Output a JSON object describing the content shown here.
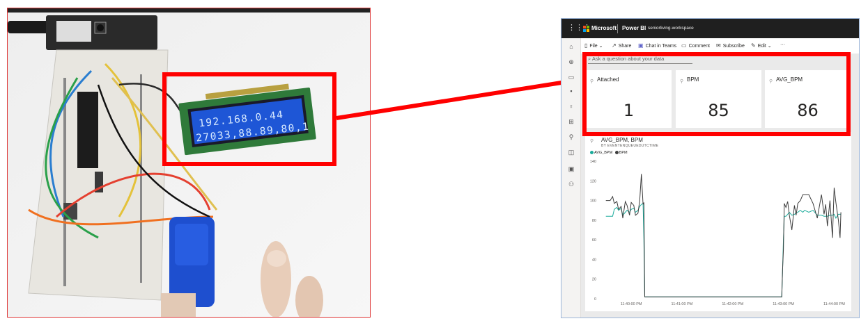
{
  "photo": {
    "lcd_line1": "192.168.0.44",
    "lcd_line2": "27033,88.89,80,1"
  },
  "powerbi": {
    "topbar": {
      "brand": "Microsoft",
      "product": "Power BI",
      "workspace": "seniorliving-workspace"
    },
    "toolbar": {
      "file": "File",
      "share": "Share",
      "chat": "Chat in Teams",
      "comment": "Comment",
      "subscribe": "Subscribe",
      "edit": "Edit",
      "more": "···"
    },
    "qa_placeholder": "Ask a question about your data",
    "tiles": [
      {
        "title": "Attached",
        "value": "1"
      },
      {
        "title": "BPM",
        "value": "85"
      },
      {
        "title": "AVG_BPM",
        "value": "86"
      }
    ],
    "chart_title": "AVG_BPM, BPM",
    "chart_subtitle": "BY EVENTENQUEUEDUTCTIME",
    "colors": {
      "avg_bpm": "#1aab9b",
      "bpm": "#3d3d3d",
      "accent_red": "#ff0000"
    }
  },
  "chart_data": {
    "type": "line",
    "title": "AVG_BPM, BPM",
    "subtitle": "BY EVENTENQUEUEDUTCTIME",
    "xlabel": "",
    "ylabel": "",
    "ylim": [
      0,
      140
    ],
    "yticks": [
      "0",
      "20",
      "40",
      "60",
      "80",
      "100",
      "120",
      "140"
    ],
    "xticks": [
      "11:40:00 PM",
      "11:41:00 PM",
      "11:42:00 PM",
      "11:43:00 PM",
      "11:44:00 PM"
    ],
    "x_seconds_from_1140": [
      -30,
      -27,
      -25,
      -22,
      -20,
      -17,
      -15,
      -12,
      -10,
      -7,
      -5,
      -2,
      0,
      3,
      5,
      8,
      10,
      12,
      14,
      15,
      16,
      17,
      18,
      30,
      60,
      90,
      120,
      150,
      175,
      176,
      177,
      178,
      179,
      180,
      181,
      183,
      185,
      187,
      190,
      193,
      195,
      197,
      200,
      203,
      205,
      210,
      215,
      220,
      225,
      228,
      230,
      232,
      235,
      238,
      240,
      242,
      245,
      247,
      248
    ],
    "series": [
      {
        "name": "AVG_BPM",
        "color": "#1aab9b",
        "values": [
          84,
          84,
          84,
          84,
          91,
          93,
          90,
          92,
          85,
          88,
          90,
          88,
          91,
          92,
          88,
          90,
          94,
          96,
          97,
          60,
          2,
          2,
          2,
          2,
          2,
          2,
          2,
          2,
          2,
          2,
          2,
          2,
          30,
          60,
          84,
          84,
          86,
          88,
          85,
          86,
          87,
          88,
          90,
          88,
          90,
          88,
          90,
          85,
          85,
          84,
          84,
          84,
          85,
          85,
          86,
          82,
          86,
          86,
          86
        ]
      },
      {
        "name": "BPM",
        "color": "#3d3d3d",
        "values": [
          100,
          100,
          100,
          104,
          97,
          99,
          91,
          94,
          82,
          99,
          95,
          85,
          98,
          95,
          85,
          87,
          100,
          127,
          96,
          98,
          2,
          2,
          2,
          2,
          2,
          2,
          2,
          2,
          2,
          2,
          2,
          2,
          30,
          50,
          97,
          93,
          99,
          85,
          70,
          95,
          85,
          97,
          100,
          106,
          106,
          106,
          97,
          82,
          106,
          86,
          96,
          74,
          100,
          62,
          113,
          98,
          80,
          62,
          88
        ]
      }
    ],
    "legend": "top-left",
    "grid": false
  }
}
